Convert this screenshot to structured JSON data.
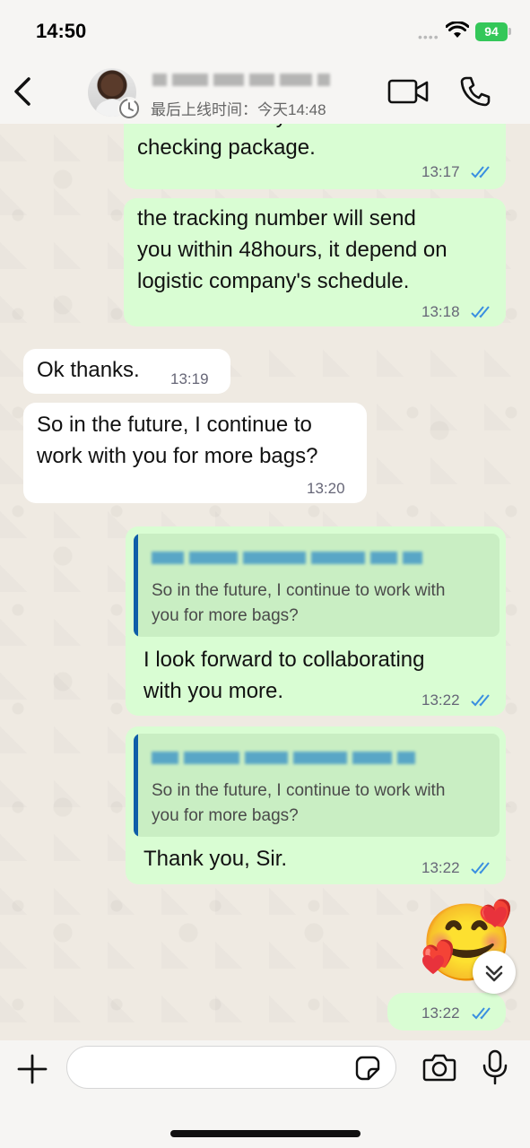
{
  "status_bar": {
    "time": "14:50",
    "battery": "94"
  },
  "header": {
    "last_seen": "最后上线时间：今天14:48"
  },
  "messages": [
    {
      "dir": "out",
      "text_lines": [
        "have to waste your time on",
        "checking package."
      ],
      "time": "13:17",
      "read": true
    },
    {
      "dir": "out",
      "text_lines": [
        "the tracking number will send",
        "you within 48hours, it depend on",
        "logistic company's schedule."
      ],
      "time": "13:18",
      "read": true
    },
    {
      "dir": "in",
      "text_lines": [
        "Ok thanks."
      ],
      "time": "13:19"
    },
    {
      "dir": "in",
      "text_lines": [
        "So in the future, I continue to",
        "work with you for more bags?"
      ],
      "time": "13:20"
    },
    {
      "dir": "out",
      "quote_lines": [
        "So in the future, I continue to work with",
        "you for more bags?"
      ],
      "text_lines": [
        "I look forward to collaborating",
        "with you more."
      ],
      "time": "13:22",
      "read": true
    },
    {
      "dir": "out",
      "quote_lines": [
        "So in the future, I continue to work with",
        "you for more bags?"
      ],
      "text_lines": [
        "Thank you, Sir."
      ],
      "time": "13:22",
      "read": true
    },
    {
      "dir": "out",
      "emoji": "🥰",
      "time": "13:22",
      "read": true
    }
  ],
  "colors": {
    "outgoing_bubble": "#d9fdd3",
    "incoming_bubble": "#ffffff",
    "read_ticks": "#3a8fe0",
    "quote_bar": "#0f5ea8"
  },
  "icons": [
    "back-icon",
    "video-call-icon",
    "phone-icon",
    "plus-icon",
    "sticker-icon",
    "camera-icon",
    "mic-icon",
    "chevron-down-icon"
  ]
}
